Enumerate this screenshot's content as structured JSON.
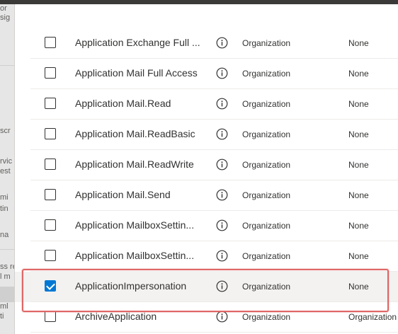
{
  "background_fragments": [
    "or",
    "sig",
    "scr",
    "rvic",
    "est",
    "mi",
    "tin",
    "na",
    "ss re",
    "l m",
    "ml",
    "ti"
  ],
  "permissions": [
    {
      "name": "Application Exchange Full ...",
      "admin_consent": "Organization",
      "consent_status": "None",
      "checked": false
    },
    {
      "name": "Application Mail Full Access",
      "admin_consent": "Organization",
      "consent_status": "None",
      "checked": false
    },
    {
      "name": "Application Mail.Read",
      "admin_consent": "Organization",
      "consent_status": "None",
      "checked": false
    },
    {
      "name": "Application Mail.ReadBasic",
      "admin_consent": "Organization",
      "consent_status": "None",
      "checked": false
    },
    {
      "name": "Application Mail.ReadWrite",
      "admin_consent": "Organization",
      "consent_status": "None",
      "checked": false
    },
    {
      "name": "Application Mail.Send",
      "admin_consent": "Organization",
      "consent_status": "None",
      "checked": false
    },
    {
      "name": "Application MailboxSettin...",
      "admin_consent": "Organization",
      "consent_status": "None",
      "checked": false
    },
    {
      "name": "Application MailboxSettin...",
      "admin_consent": "Organization",
      "consent_status": "None",
      "checked": false
    },
    {
      "name": "ApplicationImpersonation",
      "admin_consent": "Organization",
      "consent_status": "None",
      "checked": true
    },
    {
      "name": "ArchiveApplication",
      "admin_consent": "Organization",
      "consent_status": "Organization",
      "checked": false
    }
  ],
  "icons": {
    "info": "info-icon",
    "checkmark": "checkmark-icon"
  },
  "colors": {
    "accent": "#0078d4",
    "highlight": "#e06666",
    "selected_row": "#f3f2f1"
  }
}
